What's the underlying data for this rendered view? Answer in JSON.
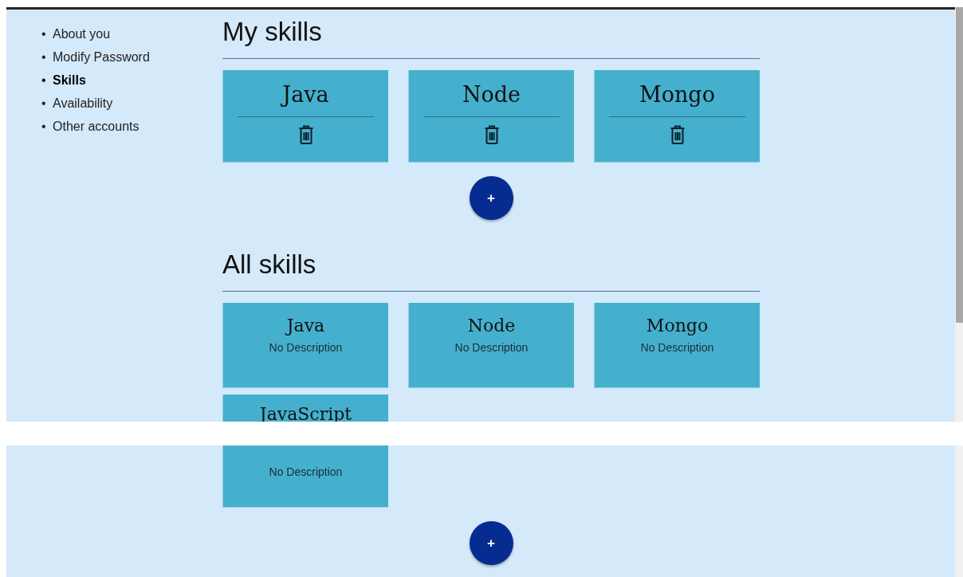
{
  "sidebar": {
    "items": [
      {
        "bullet": "•",
        "label": "About you",
        "selected": false
      },
      {
        "bullet": "•",
        "label": "Modify Password",
        "selected": false
      },
      {
        "bullet": "•",
        "label": "Skills",
        "selected": true
      },
      {
        "bullet": "•",
        "label": "Availability",
        "selected": false
      },
      {
        "bullet": "•",
        "label": "Other accounts",
        "selected": false
      }
    ]
  },
  "sections": [
    {
      "title": "My skills",
      "kind": "owned",
      "cards": [
        {
          "name": "Java"
        },
        {
          "name": "Node"
        },
        {
          "name": "Mongo"
        }
      ],
      "add_button": "+"
    },
    {
      "title": "All skills",
      "kind": "catalog",
      "cards": [
        {
          "name": "Java",
          "description": "No Description"
        },
        {
          "name": "Node",
          "description": "No Description"
        },
        {
          "name": "Mongo",
          "description": "No Description"
        },
        {
          "name": "JavaScript",
          "description": "No Description"
        }
      ],
      "add_button": "+"
    }
  ]
}
